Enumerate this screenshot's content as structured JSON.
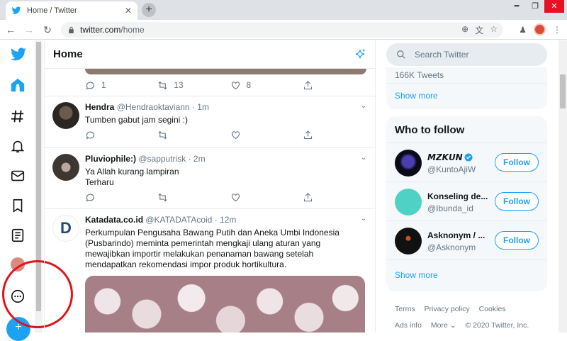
{
  "browser": {
    "tab_title": "Home / Twitter",
    "url_host": "twitter.com",
    "url_path": "/home"
  },
  "feed": {
    "title": "Home",
    "tweet0": {
      "reply_count": "1",
      "retweet_count": "13",
      "like_count": "8"
    },
    "tweets": [
      {
        "name": "Hendra",
        "handle": "@Hendraoktaviann",
        "sep": "·",
        "time": "1m",
        "text": "Tumben gabut jam segini :)"
      },
      {
        "name": "Pluviophile:)",
        "handle": "@sapputrisk",
        "sep": "·",
        "time": "2m",
        "text": "Ya Allah kurang lampiran\nTerharu"
      },
      {
        "name": "Katadata.co.id",
        "handle": "@KATADATAcoid",
        "sep": "·",
        "time": "12m",
        "text": "Perkumpulan Pengusaha Bawang Putih dan Aneka Umbi Indonesia (Pusbarindo) meminta pemerintah mengkaji ulang aturan yang mewajibkan importir melakukan penanaman bawang setelah mendapatkan rekomendasi impor produk hortikultura."
      }
    ],
    "katadata_logo": "D"
  },
  "sidebar": {
    "search_placeholder": "Search Twitter",
    "trend_count": "166K Tweets",
    "show_more_1": "Show more",
    "who_to_follow_title": "Who to follow",
    "follow_items": [
      {
        "name": "𝙈𝙕𝙆𝙐𝙉",
        "handle": "@KuntoAjiW",
        "button": "Follow"
      },
      {
        "name": "Konseling de...",
        "handle": "@Ibunda_id",
        "button": "Follow"
      },
      {
        "name": "Asknonym / ...",
        "handle": "@Asknonym",
        "button": "Follow"
      }
    ],
    "show_more_2": "Show more",
    "footer": [
      "Terms",
      "Privacy policy",
      "Cookies",
      "Ads info",
      "More ⌄",
      "© 2020 Twitter, Inc."
    ]
  },
  "colors": {
    "twitter_blue": "#1da1f2",
    "annotation_red": "#e0141e"
  }
}
